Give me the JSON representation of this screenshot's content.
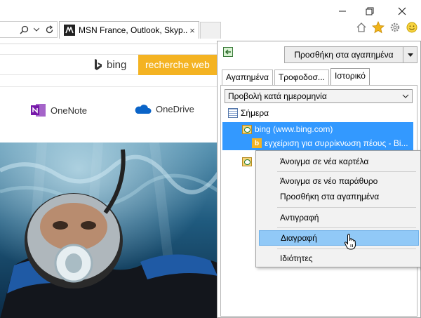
{
  "browser": {
    "tab_title": "MSN France, Outlook, Skyp...",
    "tab_favicon": "msn-icon",
    "tab_close": "×",
    "toolbar_icons": [
      "home-icon",
      "favorites-star-icon",
      "settings-gear-icon",
      "smiley-icon"
    ]
  },
  "page": {
    "bing_logo_text": "bing",
    "bing_search_button": "recherche web",
    "apps": [
      {
        "name": "OneNote",
        "icon": "onenote-icon",
        "color": "#7719aa"
      },
      {
        "name": "OneDrive",
        "icon": "onedrive-icon",
        "color": "#0a64c8"
      }
    ]
  },
  "favorites_pane": {
    "add_button": "Προσθήκη στα αγαπημένα",
    "tabs": [
      "Αγαπημένα",
      "Τροφοδοσ...",
      "Ιστορικό"
    ],
    "active_tab": "Ιστορικό",
    "view_select": "Προβολή κατά ημερομηνία",
    "tree": {
      "today": "Σήμερα",
      "site": "bing (www.bing.com)",
      "page": "εγχείριση για συρρίκνωση πέους - Bi..."
    }
  },
  "context_menu": {
    "items": [
      {
        "label": "Άνοιγμα σε νέα καρτέλα",
        "highlighted": false
      },
      {
        "label": "Άνοιγμα σε νέο παράθυρο",
        "highlighted": false
      },
      {
        "label": "Προσθήκη στα αγαπημένα",
        "highlighted": false
      },
      {
        "label": "Αντιγραφή",
        "highlighted": false
      },
      {
        "label": "Διαγραφή",
        "highlighted": true
      },
      {
        "label": "Ιδιότητες",
        "highlighted": false
      }
    ]
  },
  "colors": {
    "selection": "#3399ff",
    "menu_highlight": "#91c9f7",
    "bing_orange": "#f4b322"
  }
}
